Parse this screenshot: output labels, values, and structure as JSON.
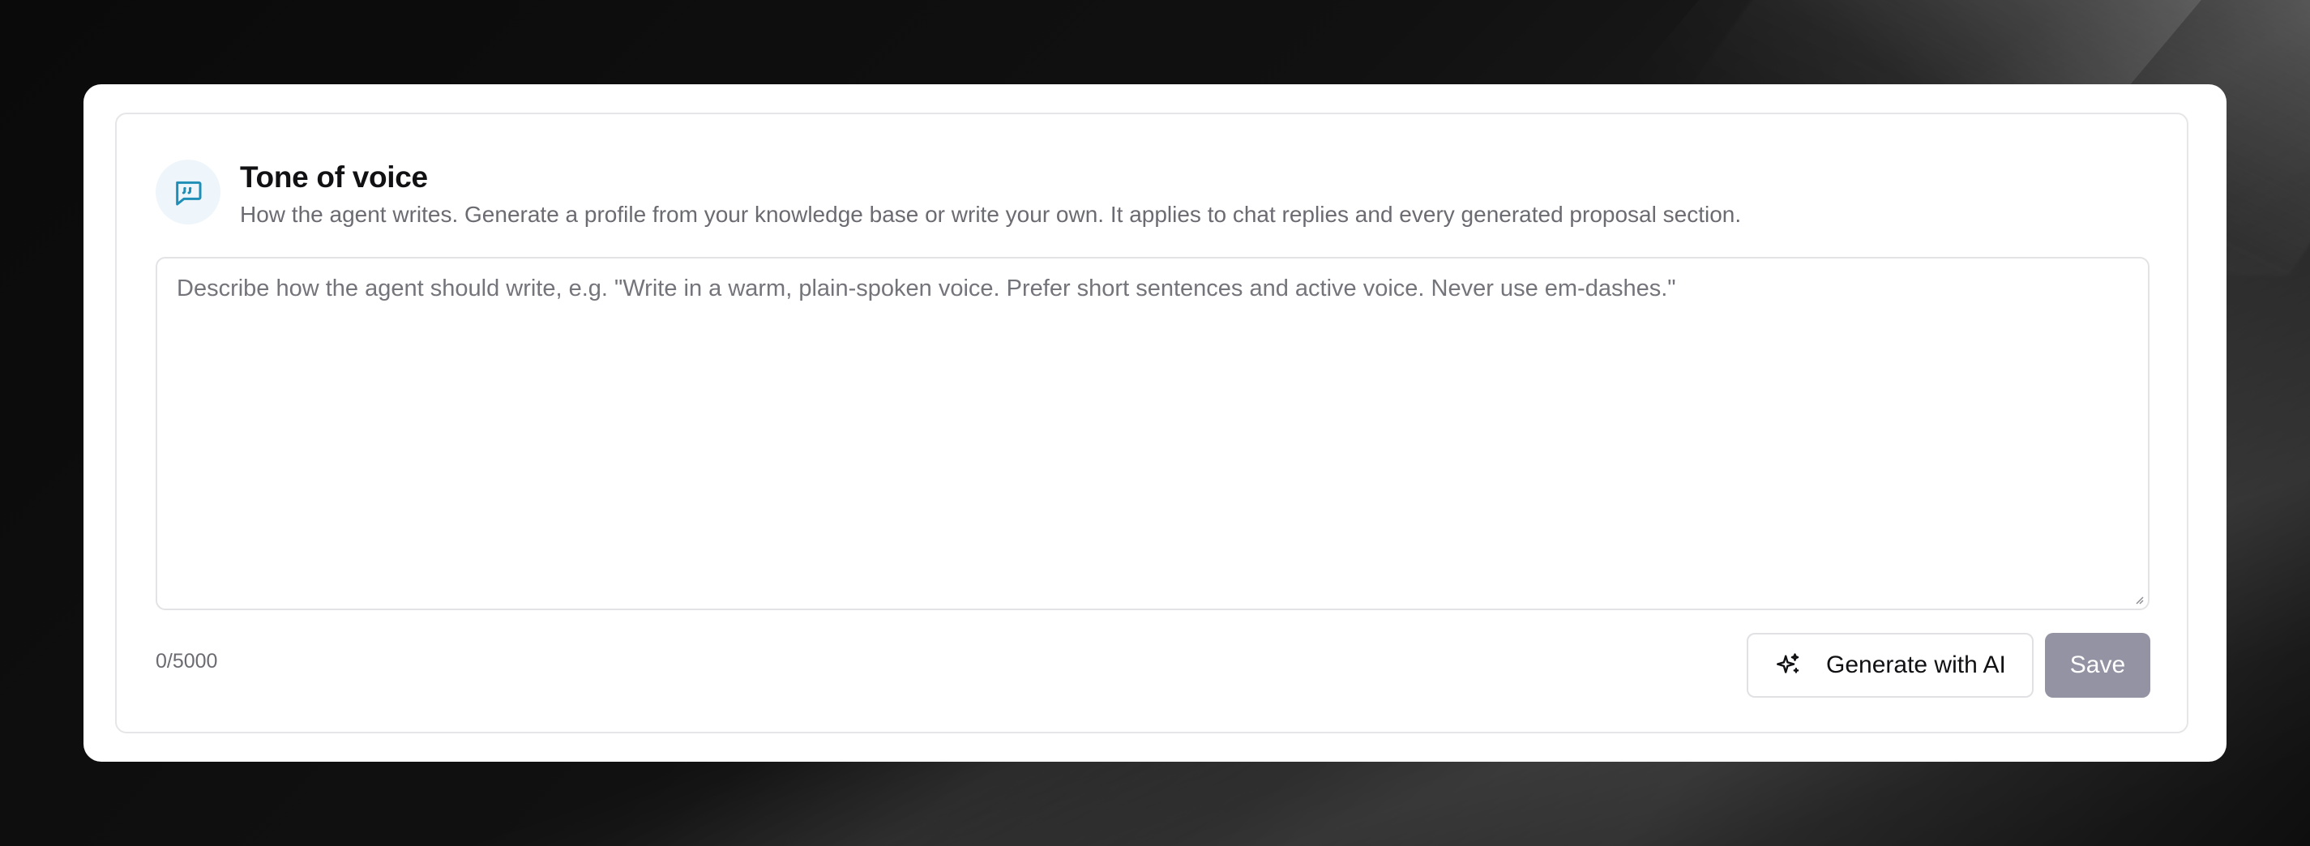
{
  "section": {
    "title": "Tone of voice",
    "description": "How the agent writes. Generate a profile from your knowledge base or write your own. It applies to chat replies and every generated proposal section.",
    "icon": "chat-quote-icon"
  },
  "editor": {
    "value": "",
    "placeholder": "Describe how the agent should write, e.g. \"Write in a warm, plain-spoken voice. Prefer short sentences and active voice. Never use em-dashes.\"",
    "counter": "0/5000"
  },
  "actions": {
    "generate_label": "Generate with AI",
    "generate_icon": "sparkles-icon",
    "save_label": "Save"
  },
  "colors": {
    "accent": "#1f8fb8",
    "icon_bg": "#eef6fb",
    "save_disabled": "#9393a3"
  }
}
